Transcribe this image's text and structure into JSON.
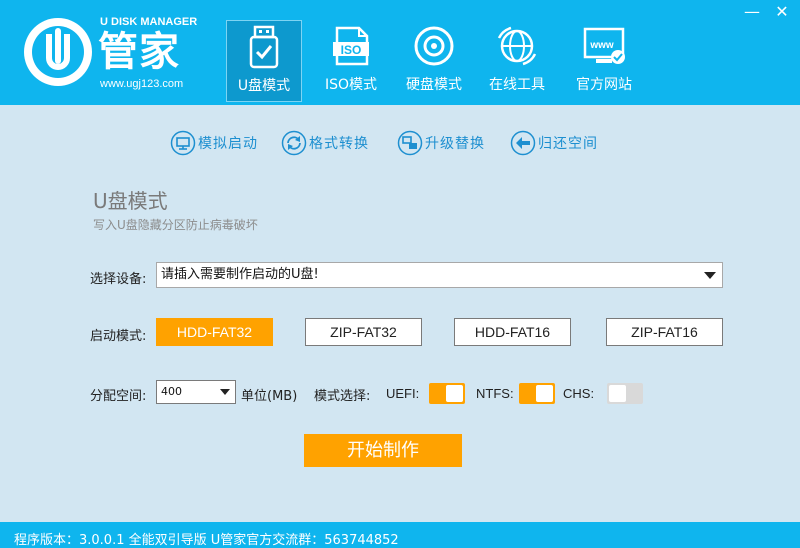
{
  "brand": {
    "en_name": "U DISK MANAGER",
    "cn_name": "管家",
    "url": "www.ugj123.com"
  },
  "nav": [
    {
      "label": "U盘模式",
      "icon": "usb-check-icon",
      "active": true
    },
    {
      "label": "ISO模式",
      "icon": "iso-file-icon",
      "active": false
    },
    {
      "label": "硬盘模式",
      "icon": "disc-icon",
      "active": false
    },
    {
      "label": "在线工具",
      "icon": "globe-icon",
      "active": false
    },
    {
      "label": "官方网站",
      "icon": "www-monitor-icon",
      "active": false
    }
  ],
  "window": {
    "minimize": "—",
    "close": "✕"
  },
  "actions": [
    {
      "label": "模拟启动",
      "icon": "monitor-icon"
    },
    {
      "label": "格式转换",
      "icon": "refresh-icon"
    },
    {
      "label": "升级替换",
      "icon": "swap-icon"
    },
    {
      "label": "归还空间",
      "icon": "back-arrow-icon"
    }
  ],
  "section": {
    "title": "U盘模式",
    "subtitle": "写入U盘隐藏分区防止病毒破坏"
  },
  "device": {
    "label": "选择设备:",
    "value": "请插入需要制作启动的U盘!"
  },
  "boot_mode": {
    "label": "启动模式:",
    "options": [
      {
        "label": "HDD-FAT32",
        "active": true
      },
      {
        "label": "ZIP-FAT32",
        "active": false
      },
      {
        "label": "HDD-FAT16",
        "active": false
      },
      {
        "label": "ZIP-FAT16",
        "active": false
      }
    ]
  },
  "alloc": {
    "label": "分配空间:",
    "value": "400",
    "unit": "单位(MB)"
  },
  "mode_select": {
    "label": "模式选择:",
    "uefi_label": "UEFI:",
    "uefi_on": true,
    "ntfs_label": "NTFS:",
    "ntfs_on": true,
    "chs_label": "CHS:",
    "chs_on": false
  },
  "start_button": "开始制作",
  "status": "程序版本：3.0.0.1 全能双引导版 U管家官方交流群：563744852",
  "colors": {
    "header": "#0fb5ee",
    "background": "#d2e6f2",
    "accent": "#ffa200",
    "action_text": "#1d8fd0"
  }
}
